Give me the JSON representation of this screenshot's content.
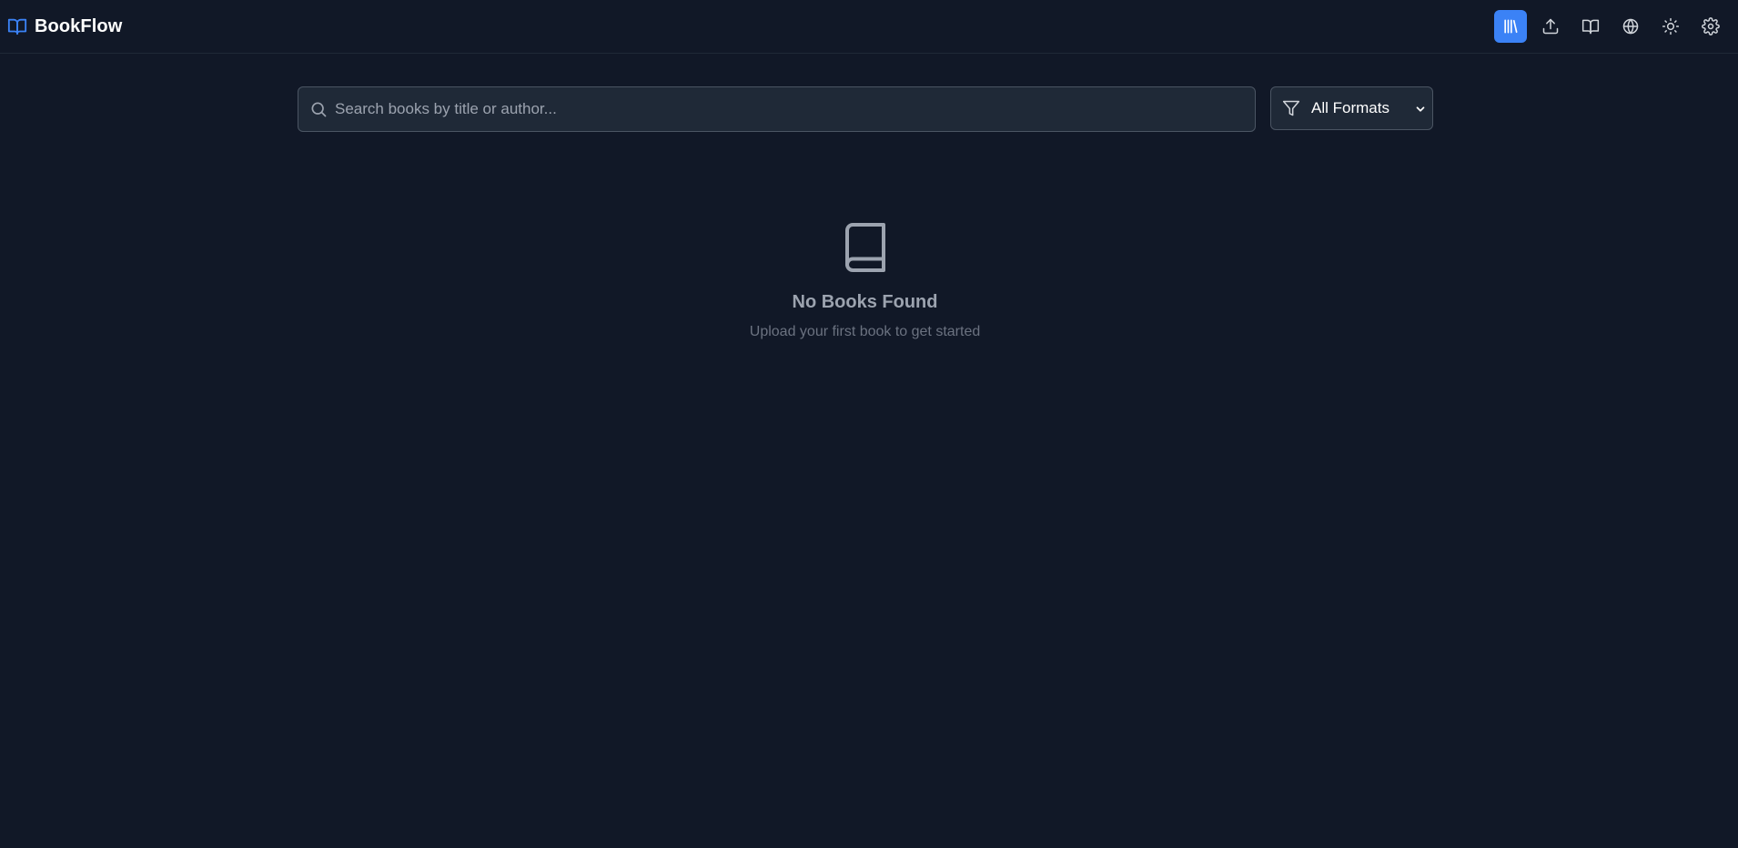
{
  "app": {
    "name": "BookFlow"
  },
  "nav": {
    "items": [
      {
        "icon": "library-icon",
        "active": true
      },
      {
        "icon": "upload-icon",
        "active": false
      },
      {
        "icon": "book-open-icon",
        "active": false
      },
      {
        "icon": "globe-icon",
        "active": false
      },
      {
        "icon": "sun-icon",
        "active": false
      },
      {
        "icon": "gear-icon",
        "active": false
      }
    ]
  },
  "search": {
    "placeholder": "Search books by title or author...",
    "value": ""
  },
  "filter": {
    "selected": "All Formats"
  },
  "empty_state": {
    "title": "No Books Found",
    "subtitle": "Upload your first book to get started"
  },
  "colors": {
    "background": "#111827",
    "accent": "#3b82f6",
    "input_background": "#1f2937",
    "border": "#4b5563"
  }
}
